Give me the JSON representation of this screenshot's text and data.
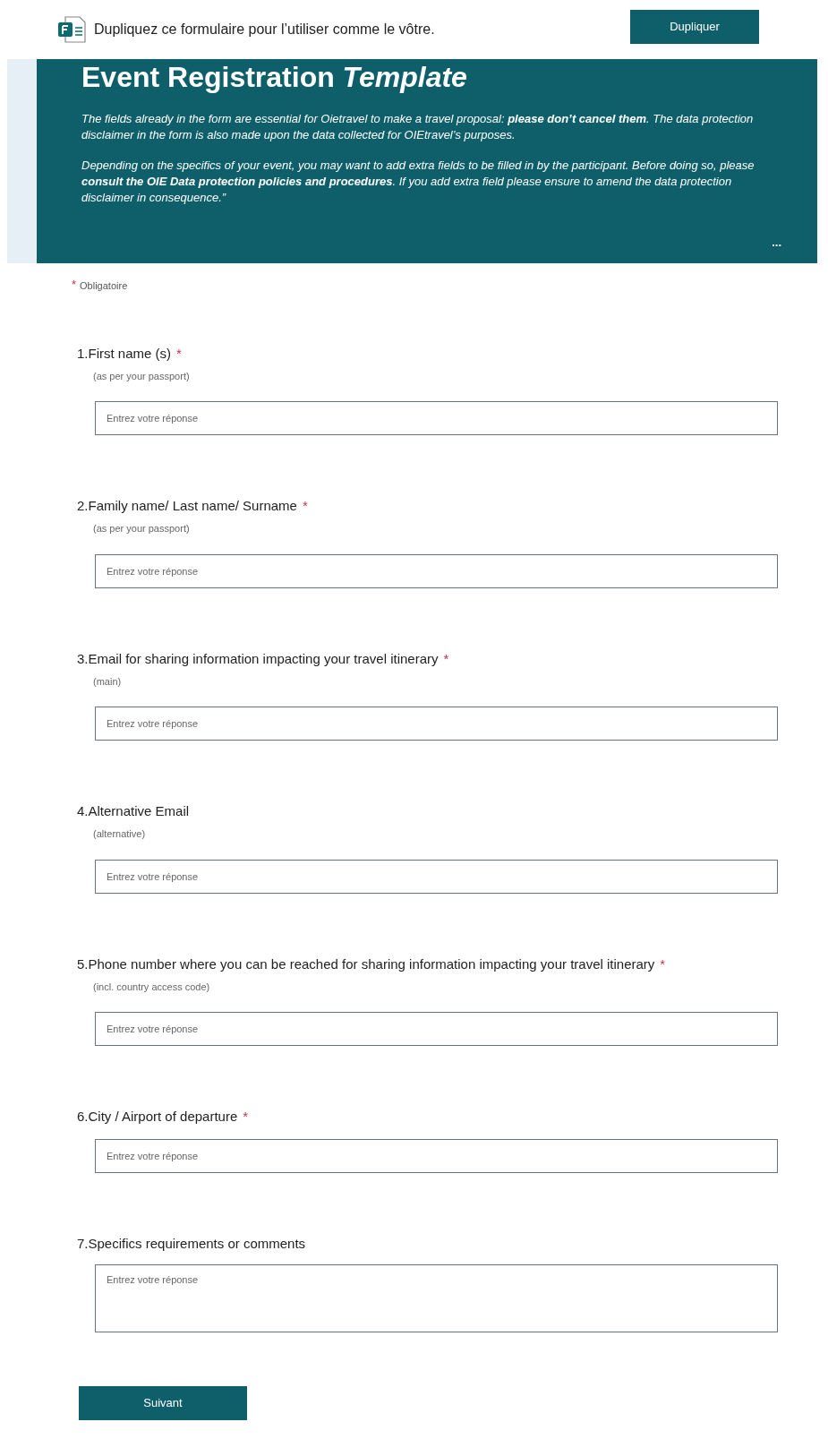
{
  "notice": {
    "text": "Dupliquez ce formulaire pour l’utiliser comme le vôtre.",
    "button": "Dupliquer"
  },
  "header": {
    "title": "Event Registration *Template*",
    "paragraphs": [
      "The fields already in the form are essential for Oietravel to make a travel proposal: **please don’t cancel them**. The data protection disclaimer in the form is also made upon the data collected for OIEtravel’s purposes.",
      "Depending on the specifics of your event, you may want to add extra fields to be filled in by the participant. Before doing so, please **consult the OIE Data protection policies and procedures**. If you add extra field please ensure to amend the data protection disclaimer in consequence.”"
    ],
    "more": "..."
  },
  "required_note": {
    "mark": "*",
    "text": "Obligatoire"
  },
  "questions": [
    {
      "number": "1.",
      "label": "First name (s)",
      "required": true,
      "subtitle": "(as per your passport)",
      "kind": "line",
      "placeholder": "Entrez votre réponse"
    },
    {
      "number": "2.",
      "label": "Family name/ Last name/ Surname",
      "required": true,
      "subtitle": "(as per your passport)",
      "kind": "line",
      "placeholder": "Entrez votre réponse"
    },
    {
      "number": "3.",
      "label": "Email for sharing information impacting your travel itinerary",
      "required": true,
      "subtitle": "(main)",
      "kind": "line",
      "placeholder": "Entrez votre réponse"
    },
    {
      "number": "4.",
      "label": "Alternative Email",
      "required": false,
      "subtitle": "(alternative)",
      "kind": "line",
      "placeholder": "Entrez votre réponse"
    },
    {
      "number": "5.",
      "label": "Phone number where you can be reached for sharing information impacting your travel itinerary",
      "required": true,
      "subtitle": "(incl. country access code)",
      "kind": "line",
      "placeholder": "Entrez votre réponse"
    },
    {
      "number": "6.",
      "label": "City / Airport of departure",
      "required": true,
      "kind": "line",
      "placeholder": "Entrez votre réponse"
    },
    {
      "number": "7.",
      "label": "Specifics requirements or comments",
      "required": false,
      "kind": "long",
      "placeholder": "Entrez votre réponse"
    }
  ],
  "next_button": "Suivant"
}
